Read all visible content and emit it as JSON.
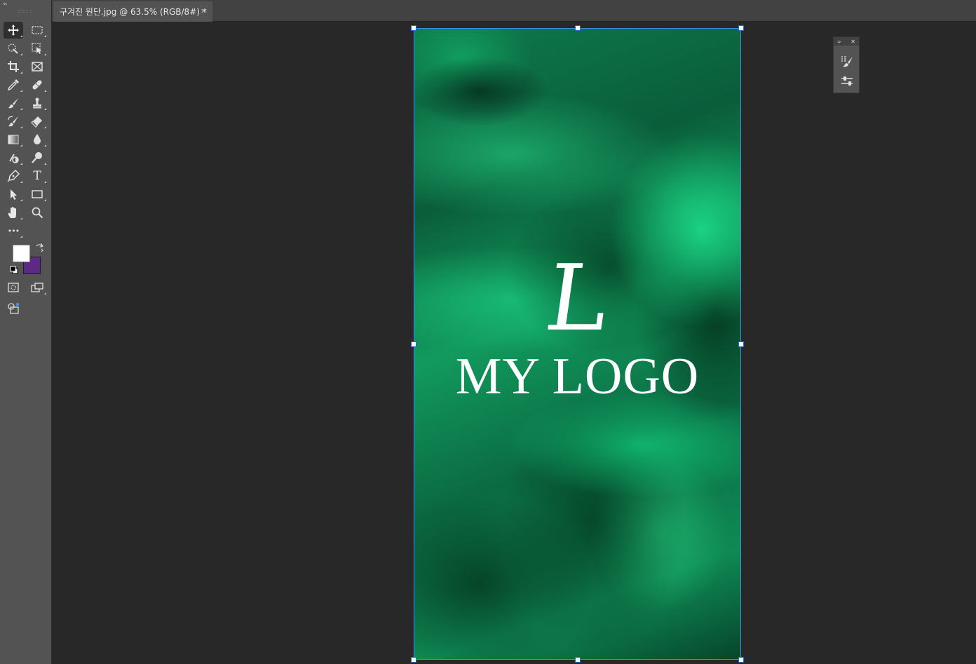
{
  "tab": {
    "title": "구겨진 원단.jpg @ 63.5% (RGB/8#) *",
    "close": "×"
  },
  "toolbar": {
    "collapse": "‹‹",
    "tools": [
      {
        "name": "move-tool",
        "icon": "move-icon",
        "active": true
      },
      {
        "name": "rectangular-marquee-tool",
        "icon": "marquee-icon"
      },
      {
        "name": "quick-selection-tool",
        "icon": "quick-select-icon"
      },
      {
        "name": "object-selection-tool",
        "icon": "object-select-icon"
      },
      {
        "name": "crop-tool",
        "icon": "crop-icon"
      },
      {
        "name": "frame-tool",
        "icon": "frame-icon"
      },
      {
        "name": "eyedropper-tool",
        "icon": "eyedropper-icon"
      },
      {
        "name": "spot-healing-tool",
        "icon": "healing-icon"
      },
      {
        "name": "brush-tool",
        "icon": "brush-icon"
      },
      {
        "name": "clone-stamp-tool",
        "icon": "stamp-icon"
      },
      {
        "name": "history-brush-tool",
        "icon": "history-brush-icon"
      },
      {
        "name": "eraser-tool",
        "icon": "eraser-icon"
      },
      {
        "name": "gradient-tool",
        "icon": "gradient-icon"
      },
      {
        "name": "blur-tool",
        "icon": "blur-icon"
      },
      {
        "name": "dodge-tool",
        "icon": "dodge-icon"
      },
      {
        "name": "burn-tool",
        "icon": "burn-icon"
      },
      {
        "name": "pen-tool",
        "icon": "pen-icon"
      },
      {
        "name": "type-tool",
        "icon": "type-icon",
        "glyph": "T"
      },
      {
        "name": "path-selection-tool",
        "icon": "arrow-icon"
      },
      {
        "name": "rectangle-tool",
        "icon": "rectangle-icon"
      },
      {
        "name": "hand-tool",
        "icon": "hand-icon"
      },
      {
        "name": "zoom-tool",
        "icon": "zoom-icon"
      },
      {
        "name": "edit-toolbar",
        "icon": "more-icon",
        "glyph": "•••"
      }
    ],
    "foreground_color": "#ffffff",
    "background_color": "#5b2a86"
  },
  "document": {
    "logo_letter": "L",
    "logo_text": "MY LOGO"
  },
  "float_panel": {
    "expand": "››",
    "close": "✕"
  },
  "colors": {
    "app_bg": "#282828",
    "toolbar_bg": "#535353",
    "tabbar_bg": "#424242",
    "selection_accent": "#3d8ef0"
  }
}
